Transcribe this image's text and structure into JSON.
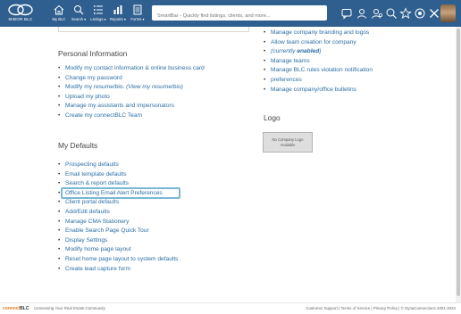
{
  "topbar": {
    "logo_text": "MIBOR BLC",
    "nav": [
      {
        "label": "My BLC",
        "icon": "home-icon"
      },
      {
        "label": "Search ▾",
        "icon": "search-icon"
      },
      {
        "label": "Listings ▾",
        "icon": "listings-icon"
      },
      {
        "label": "Reports ▾",
        "icon": "reports-icon"
      },
      {
        "label": "Forms ▾",
        "icon": "forms-icon"
      }
    ],
    "search_placeholder": "SmartBar - Quickly find listings, clients, and more...",
    "right_icons": [
      "chat-icon",
      "contacts-icon",
      "user-search-icon",
      "zoom-icon",
      "star-icon",
      "globe-icon",
      "tools-icon",
      "settings-icon"
    ],
    "colors": {
      "bar": "#2f5f8f",
      "link": "#2a6fa6",
      "highlight": "#7ab7d6"
    }
  },
  "personal": {
    "title": "Personal Information",
    "items": [
      "Modify my contact information & online business card",
      "Change my password",
      "Upload my photo",
      "Manage my assistants and impersonators",
      "Create my connectBLC Team"
    ],
    "resume_label": "Modify my resume/bio.",
    "resume_view": "(View my resume/bio)"
  },
  "company": {
    "items": [
      "Manage company branding and logos",
      "Allow team creation for company",
      "Manage teams",
      "Manage BLC rules violation notification",
      "preferences",
      "Manage company/office bulletins"
    ],
    "status_prefix": "(currently ",
    "status_value": "enabled",
    "status_suffix": ")"
  },
  "logo": {
    "title": "Logo",
    "placeholder_line1": "No Company Logo",
    "placeholder_line2": "Available"
  },
  "defaults": {
    "title": "My Defaults",
    "items": [
      "Prospecting defaults",
      "Email template defaults",
      "Search & report defaults",
      "Office Listing Email Alert Preferences",
      "Client portal defaults",
      "Add/Edit defaults",
      "Manage CMA Stationery",
      "Enable Search Page Quick Tour",
      "Display Settings",
      "Modify home page layout",
      "Reset home page layout to system defaults",
      "Create lead capture form"
    ]
  },
  "footer": {
    "brand_prefix": "connect",
    "brand_suffix": "BLC",
    "tagline": "Connecting Your Real Estate Community",
    "links": "Customer Support | Terms of Service | Privacy Policy | © DynaConnections 2001-2024"
  }
}
